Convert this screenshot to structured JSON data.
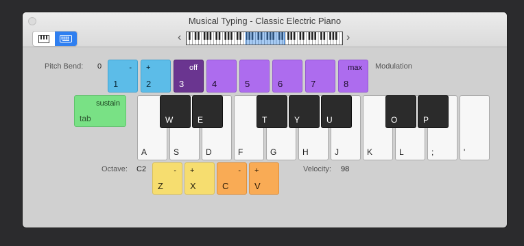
{
  "window": {
    "title": "Musical Typing - Classic Electric Piano"
  },
  "view_toggle": {
    "piano_icon": "piano-keys-icon",
    "keyboard_icon": "keyboard-icon",
    "selected": "keyboard"
  },
  "nav": {
    "prev": "‹",
    "next": "›"
  },
  "pitch_bend": {
    "label": "Pitch Bend:",
    "value": "0"
  },
  "modulation": {
    "label": "Modulation"
  },
  "number_keys": [
    {
      "key": "1",
      "tag": "-"
    },
    {
      "key": "2",
      "tag": "+"
    },
    {
      "key": "3",
      "tag": "off"
    },
    {
      "key": "4",
      "tag": ""
    },
    {
      "key": "5",
      "tag": ""
    },
    {
      "key": "6",
      "tag": ""
    },
    {
      "key": "7",
      "tag": ""
    },
    {
      "key": "8",
      "tag": "max"
    }
  ],
  "sustain": {
    "tag": "sustain",
    "key": "tab"
  },
  "white_keys": [
    "A",
    "S",
    "D",
    "F",
    "G",
    "H",
    "J",
    "K",
    "L",
    ";",
    "'"
  ],
  "black_keys": [
    "W",
    "E",
    "T",
    "Y",
    "U",
    "O",
    "P"
  ],
  "octave": {
    "label": "Octave:",
    "value": "C2"
  },
  "velocity": {
    "label": "Velocity:",
    "value": "98"
  },
  "bottom_keys": [
    {
      "key": "Z",
      "tag": "-"
    },
    {
      "key": "X",
      "tag": "+"
    },
    {
      "key": "C",
      "tag": "-"
    },
    {
      "key": "V",
      "tag": "+"
    }
  ],
  "colors": {
    "pitch": "#5cbce8",
    "mod_off": "#6a3590",
    "mod": "#ad6cee",
    "octave": "#f6dd6f",
    "velocity": "#f9ab55",
    "sustain": "#79e185"
  }
}
